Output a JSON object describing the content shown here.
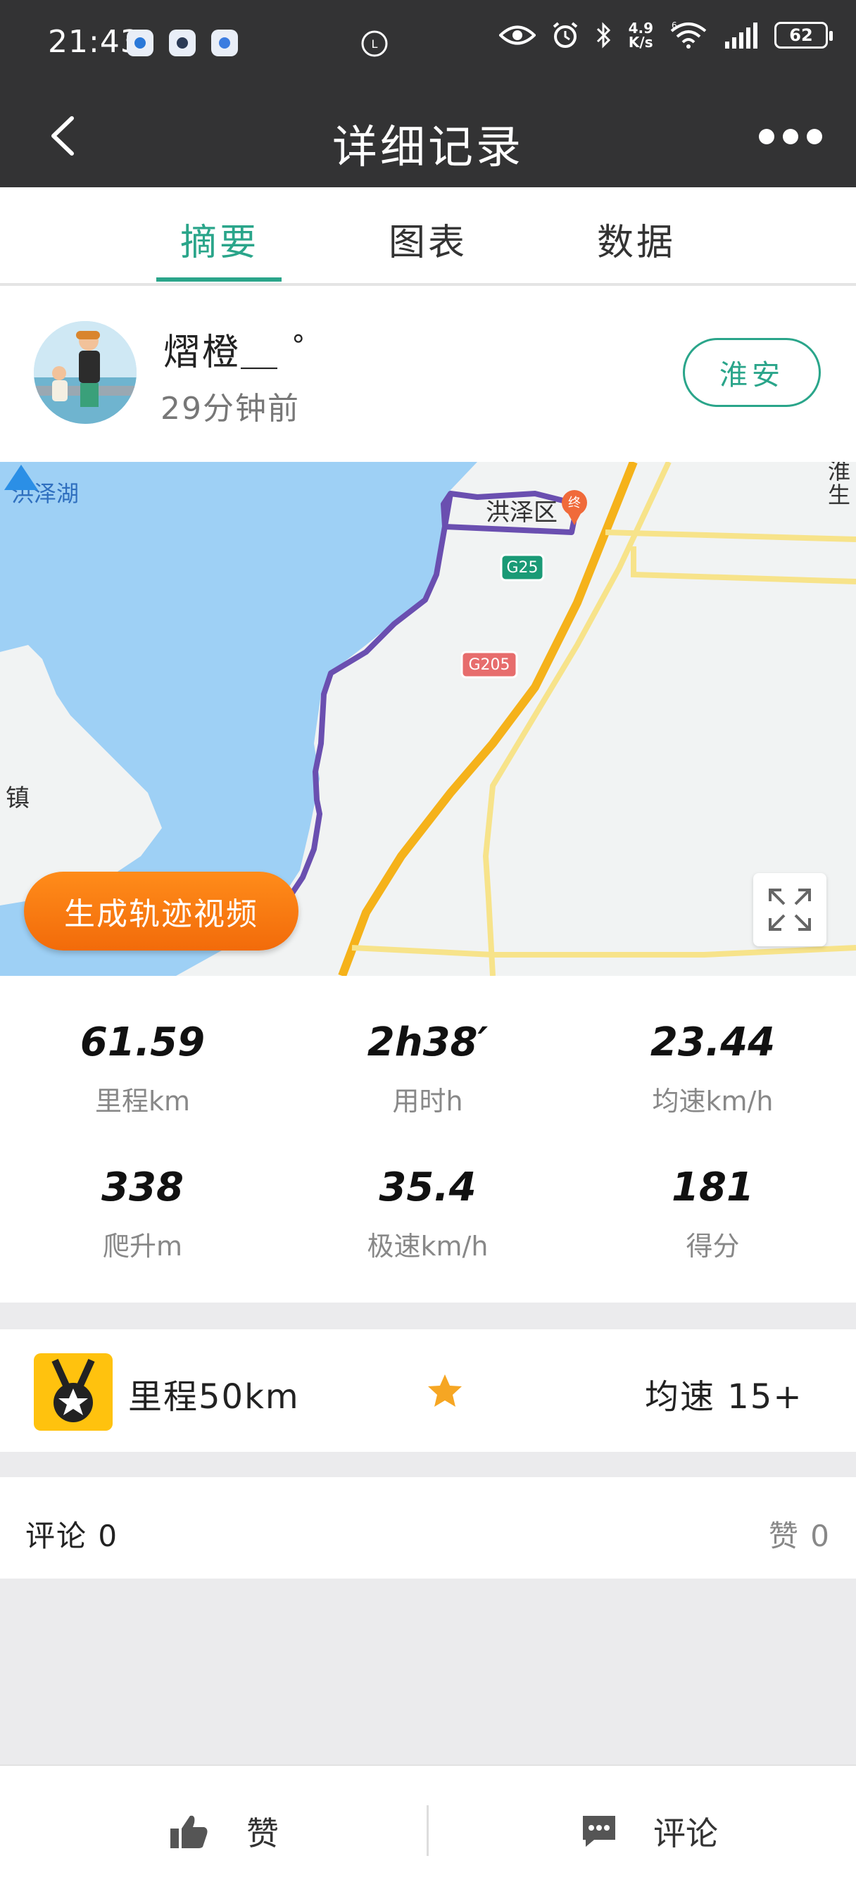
{
  "status_bar": {
    "time": "21:43",
    "net_speed_value": "4.9",
    "net_speed_unit": "K/s",
    "wifi_label": "6",
    "battery": "62"
  },
  "header": {
    "title": "详细记录"
  },
  "tabs": [
    {
      "label": "摘要",
      "active": true
    },
    {
      "label": "图表",
      "active": false
    },
    {
      "label": "数据",
      "active": false
    }
  ],
  "profile": {
    "username": "熠橙＿ ゜",
    "time_ago": "29分钟前",
    "location_button": "淮安"
  },
  "map": {
    "labels": {
      "lake": "洪泽湖",
      "district": "洪泽区",
      "town": "镇",
      "corner": "淮\n生",
      "end_marker": "终",
      "road_g25": "G25",
      "road_g205": "G205"
    },
    "generate_video_button": "生成轨迹视频",
    "route_color": "#6a4fb0",
    "highway_color": "#f5b21a",
    "water_color": "#9ed0f5"
  },
  "stats": [
    {
      "value": "61.59",
      "label": "里程km"
    },
    {
      "value": "2h38′",
      "label": "用时h"
    },
    {
      "value": "23.44",
      "label": "均速km/h"
    },
    {
      "value": "338",
      "label": "爬升m"
    },
    {
      "value": "35.4",
      "label": "极速km/h"
    },
    {
      "value": "181",
      "label": "得分"
    }
  ],
  "achievement": {
    "title": "里程50km",
    "right_text": "均速 15+"
  },
  "comments_bar": {
    "comments": "评论 0",
    "likes": "赞 0"
  },
  "bottom_bar": {
    "like_label": "赞",
    "comment_label": "评论"
  },
  "colors": {
    "accent": "#2aa58a",
    "header_bg": "#333334",
    "orange": "#f57c12",
    "medal_yellow": "#ffc20e"
  }
}
